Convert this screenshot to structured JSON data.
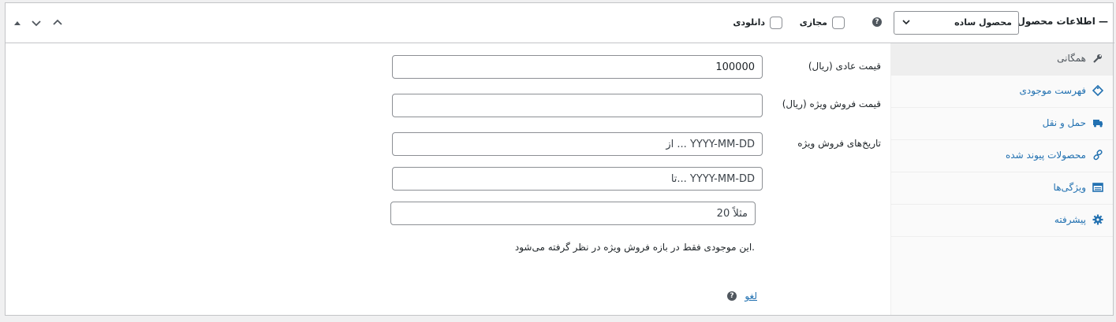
{
  "header": {
    "title": "اطلاعات محصول —",
    "product_type": "محصول ساده",
    "virtual_label": "مجازی",
    "downloadable_label": "دانلودی",
    "help": "?"
  },
  "sidebar": {
    "items": [
      {
        "label": "همگانی",
        "icon": "wrench-icon"
      },
      {
        "label": "فهرست موجودی",
        "icon": "tag-icon"
      },
      {
        "label": "حمل و نقل",
        "icon": "truck-icon"
      },
      {
        "label": "محصولات پیوند شده",
        "icon": "link-icon"
      },
      {
        "label": "ویژگی‌ها",
        "icon": "table-icon"
      },
      {
        "label": "پیشرفته",
        "icon": "gear-icon"
      }
    ]
  },
  "general": {
    "regular_price_label": "قیمت عادی (ریال)",
    "regular_price_value": "100000",
    "sale_price_label": "قیمت فروش ویژه (ریال)",
    "sale_price_value": "",
    "sale_dates_label": "تاریخ‌های فروش ویژه",
    "date_from_placeholder": "از ... YYYY-MM-DD",
    "date_to_placeholder": "تا...  YYYY-MM-DD",
    "stock_placeholder": "مثلاً 20",
    "stock_note": "این موجودی فقط در بازه فروش ویژه در نظر گرفته می‌شود.",
    "cancel_link": "لغو",
    "help": "?"
  }
}
